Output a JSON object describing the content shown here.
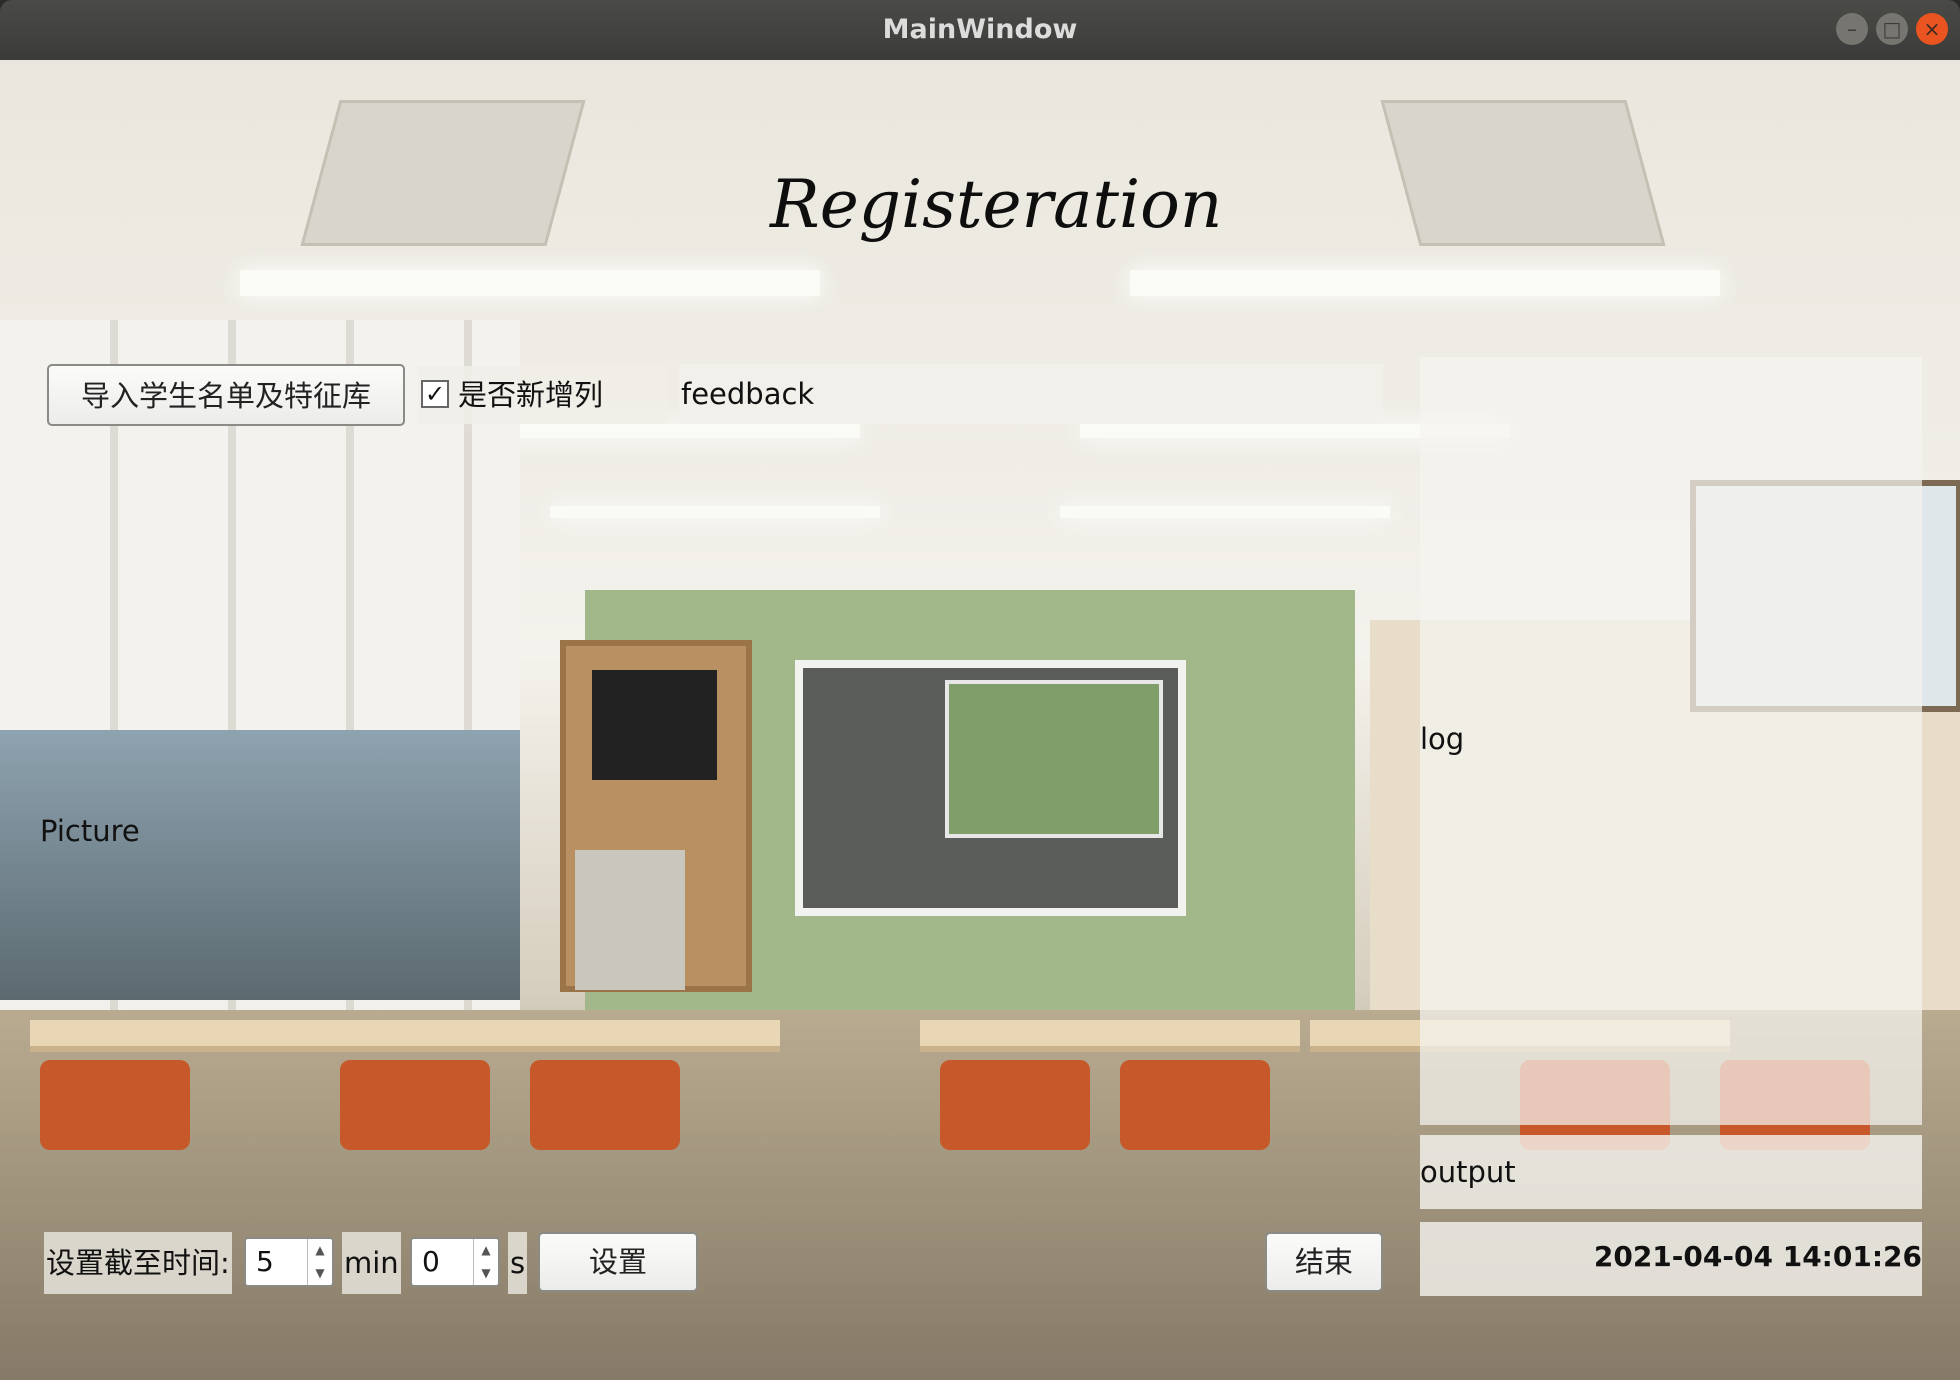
{
  "window": {
    "title": "MainWindow",
    "controls": {
      "minimize": "–",
      "maximize": "□",
      "close": "×"
    }
  },
  "main": {
    "heading": "Registeration",
    "import_button": "导入学生名单及特征库",
    "new_column_checkbox": {
      "label": "是否新增列",
      "checked": true,
      "mark": "✓"
    },
    "feedback_text": "feedback",
    "picture_label": "Picture",
    "log_label": "log",
    "output_label": "output",
    "datetime": "2021-04-04 14:01:26"
  },
  "deadline": {
    "label": "设置截至时间:",
    "minutes_value": "5",
    "minutes_unit": "min",
    "seconds_value": "0",
    "seconds_unit": "s",
    "set_button": "设置",
    "end_button": "结束"
  },
  "icons": {
    "spin_up": "▲",
    "spin_down": "▼"
  }
}
